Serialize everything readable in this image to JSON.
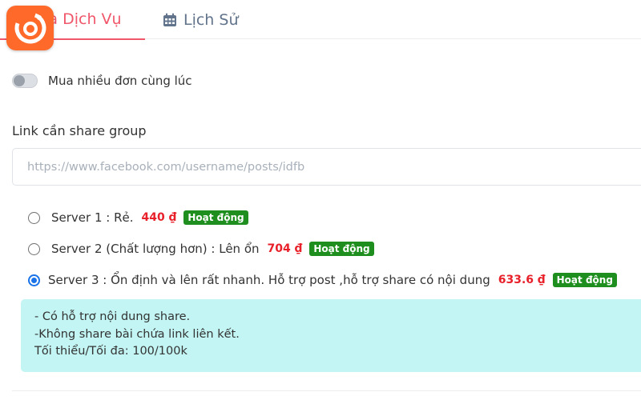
{
  "tabs": [
    {
      "label": "Mua Dịch Vụ",
      "icon": "cart-icon"
    },
    {
      "label": "Lịch Sử",
      "icon": "calendar-icon"
    }
  ],
  "multi_order": {
    "label": "Mua nhiều đơn cùng lúc",
    "enabled": false
  },
  "link_field": {
    "label": "Link cần share group",
    "value": "",
    "placeholder": "https://www.facebook.com/username/posts/idfb"
  },
  "servers": [
    {
      "name": "Server 1 : Rẻ.",
      "price": "440 ₫",
      "status": "Hoạt động",
      "selected": false
    },
    {
      "name": "Server 2 (Chất lượng hơn) : Lên ổn",
      "price": "704 ₫",
      "status": "Hoạt động",
      "selected": false
    },
    {
      "name": "Server 3 : Ổn định và lên rất nhanh. Hỗ trợ post ,hỗ trợ share có nội dung",
      "price": "633.6 ₫",
      "status": "Hoạt động",
      "selected": true
    }
  ],
  "info": {
    "lines": [
      "- Có hỗ trợ nội dung share.",
      "-Không share bài chứa link liên kết.",
      "Tối thiểu/Tối đa: 100/100k"
    ]
  },
  "colors": {
    "accent": "#f0576b",
    "price": "#e8202a",
    "badge": "#1e8e1e",
    "info_bg": "#c2f5f3",
    "radio_selected": "#1a73e8",
    "logo": "#ff6a2b"
  }
}
